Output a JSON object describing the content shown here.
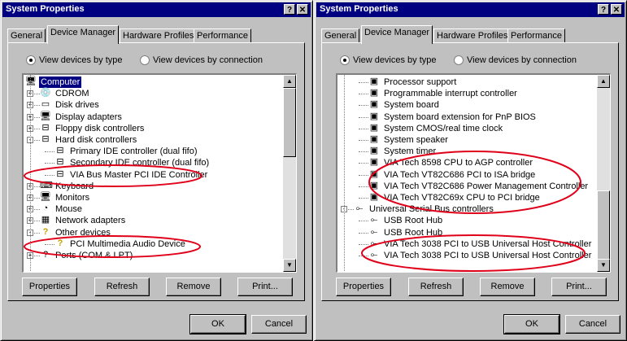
{
  "colors": {
    "title_bar": "#000080",
    "highlight_oval": "#e0001a",
    "selection": "#000080"
  },
  "left": {
    "window_title": "System Properties",
    "title_buttons": {
      "help": "?",
      "close": "✕"
    },
    "tabs": [
      "General",
      "Device Manager",
      "Hardware Profiles",
      "Performance"
    ],
    "radio_by_type": "View devices by type",
    "radio_by_connection": "View devices by connection",
    "tree": [
      {
        "label": "Computer",
        "icon": "computer-icon",
        "glyph": "🖥",
        "selected": true
      },
      {
        "label": "CDROM",
        "icon": "cdrom-icon",
        "glyph": "💿"
      },
      {
        "label": "Disk drives",
        "icon": "disk-drive-icon",
        "glyph": "▭"
      },
      {
        "label": "Display adapters",
        "icon": "display-adapter-icon",
        "glyph": "🖥"
      },
      {
        "label": "Floppy disk controllers",
        "icon": "controller-icon",
        "glyph": "⊟"
      },
      {
        "label": "Hard disk controllers",
        "icon": "controller-icon",
        "glyph": "⊟"
      },
      {
        "label": "Primary IDE controller (dual fifo)",
        "icon": "controller-icon",
        "glyph": "⊟"
      },
      {
        "label": "Secondary IDE controller (dual fifo)",
        "icon": "controller-icon",
        "glyph": "⊟"
      },
      {
        "label": "VIA Bus Master PCI IDE Controller",
        "icon": "controller-icon",
        "glyph": "⊟"
      },
      {
        "label": "Keyboard",
        "icon": "keyboard-icon",
        "glyph": "⌨"
      },
      {
        "label": "Monitors",
        "icon": "monitor-icon",
        "glyph": "🖥"
      },
      {
        "label": "Mouse",
        "icon": "mouse-icon",
        "glyph": "◔"
      },
      {
        "label": "Network adapters",
        "icon": "network-adapter-icon",
        "glyph": "▦"
      },
      {
        "label": "Other devices",
        "icon": "question-mark-icon",
        "glyph": "?"
      },
      {
        "label": "PCI Multimedia Audio Device",
        "icon": "question-mark-icon",
        "glyph": "?"
      },
      {
        "label": "Ports (COM & LPT)",
        "icon": "port-icon",
        "glyph": "?"
      }
    ],
    "buttons": {
      "properties": "Properties",
      "refresh": "Refresh",
      "remove": "Remove",
      "print": "Print..."
    },
    "ok": "OK",
    "cancel": "Cancel"
  },
  "right": {
    "window_title": "System Properties",
    "title_buttons": {
      "help": "?",
      "close": "✕"
    },
    "tabs": [
      "General",
      "Device Manager",
      "Hardware Profiles",
      "Performance"
    ],
    "radio_by_type": "View devices by type",
    "radio_by_connection": "View devices by connection",
    "tree": [
      {
        "label": "Processor support",
        "icon": "system-device-icon",
        "glyph": "▣"
      },
      {
        "label": "Programmable interrupt controller",
        "icon": "system-device-icon",
        "glyph": "▣"
      },
      {
        "label": "System board",
        "icon": "system-device-icon",
        "glyph": "▣"
      },
      {
        "label": "System board extension for PnP BIOS",
        "icon": "system-device-icon",
        "glyph": "▣"
      },
      {
        "label": "System CMOS/real time clock",
        "icon": "system-device-icon",
        "glyph": "▣"
      },
      {
        "label": "System speaker",
        "icon": "system-device-icon",
        "glyph": "▣"
      },
      {
        "label": "System timer",
        "icon": "system-device-icon",
        "glyph": "▣"
      },
      {
        "label": "VIA Tech 8598 CPU to AGP controller",
        "icon": "system-device-icon",
        "glyph": "▣"
      },
      {
        "label": "VIA Tech VT82C686 PCI to ISA bridge",
        "icon": "system-device-icon",
        "glyph": "▣"
      },
      {
        "label": "VIA Tech VT82C686 Power Management Controller",
        "icon": "system-device-icon",
        "glyph": "▣"
      },
      {
        "label": "VIA Tech VT82C69x CPU to PCI bridge",
        "icon": "system-device-icon",
        "glyph": "▣"
      },
      {
        "label": "Universal Serial Bus controllers",
        "icon": "usb-icon",
        "glyph": "⟜"
      },
      {
        "label": "USB Root Hub",
        "icon": "usb-icon",
        "glyph": "⟜"
      },
      {
        "label": "USB Root Hub",
        "icon": "usb-icon",
        "glyph": "⟜"
      },
      {
        "label": "VIA Tech 3038 PCI to USB Universal Host Controller",
        "icon": "usb-icon",
        "glyph": "⟜"
      },
      {
        "label": "VIA Tech 3038 PCI to USB Universal Host Controller",
        "icon": "usb-icon",
        "glyph": "⟜"
      }
    ],
    "buttons": {
      "properties": "Properties",
      "refresh": "Refresh",
      "remove": "Remove",
      "print": "Print..."
    },
    "ok": "OK",
    "cancel": "Cancel"
  }
}
